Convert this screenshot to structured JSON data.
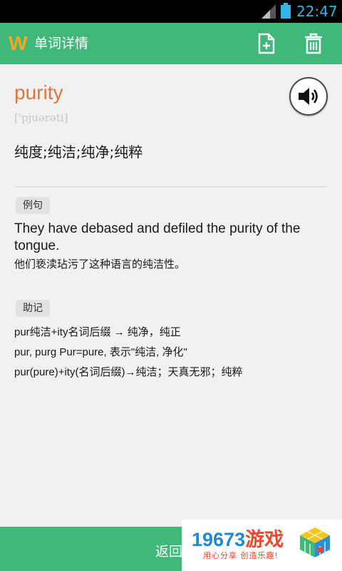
{
  "status_bar": {
    "time": "22:47"
  },
  "app_bar": {
    "logo": "W",
    "title": "单词详情",
    "icons": [
      "add-document-icon",
      "trash-icon"
    ]
  },
  "word": {
    "text": "purity",
    "phonetic": "['pjuərəti]",
    "meaning": "纯度;纯洁;纯净;纯粹"
  },
  "example": {
    "label": "例句",
    "english": "They have debased and defiled the purity of the tongue.",
    "chinese": "他们亵渎玷污了这种语言的纯洁性。"
  },
  "mnemonic": {
    "label": "助记",
    "lines": [
      "pur纯洁+ity名词后缀 → 纯净，纯正",
      "pur, purg Pur=pure, 表示\"纯洁, 净化\"",
      "pur(pure)+ity(名词后缀)→纯洁；天真无邪；纯粹"
    ]
  },
  "bottom_bar": {
    "back_label": "返回"
  },
  "watermark": {
    "number": "19673",
    "brand": "游戏",
    "slogan": "用心分享 创造乐趣!"
  },
  "colors": {
    "primary": "#3fb87a",
    "accent": "#e4733c",
    "status_time": "#33b5e5"
  }
}
